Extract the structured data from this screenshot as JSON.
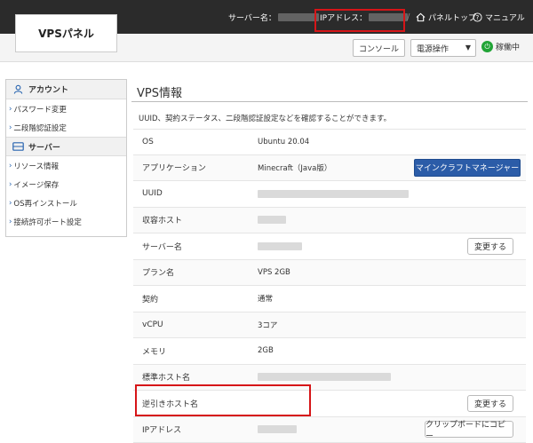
{
  "header": {
    "logo": "VPSパネル",
    "server_name_label": "サーバー名：",
    "ip_label": "IPアドレス：",
    "panel_top": "パネルトップ",
    "manual": "マニュアル"
  },
  "toolbar": {
    "console": "コンソール",
    "power_select": "電源操作",
    "status": "稼働中"
  },
  "sidebar": {
    "account_heading": "アカウント",
    "account_items": [
      "パスワード変更",
      "二段階認証設定"
    ],
    "server_heading": "サーバー",
    "server_items": [
      "リソース情報",
      "イメージ保存",
      "OS再インストール",
      "接続許可ポート設定"
    ]
  },
  "main": {
    "title": "VPS情報",
    "description": "UUID、契約ステータス、二段階認証設定などを確認することができます。",
    "rows": [
      {
        "label": "OS",
        "value": "Ubuntu 20.04"
      },
      {
        "label": "アプリケーション",
        "value": "Minecraft（Java版）",
        "button": "マインクラフトマネージャー"
      },
      {
        "label": "UUID",
        "value": ""
      },
      {
        "label": "収容ホスト",
        "value": ""
      },
      {
        "label": "サーバー名",
        "value": "",
        "button": "変更する"
      },
      {
        "label": "プラン名",
        "value": "VPS 2GB"
      },
      {
        "label": "契約",
        "value": "通常"
      },
      {
        "label": "vCPU",
        "value": "3コア"
      },
      {
        "label": "メモリ",
        "value": "2GB"
      },
      {
        "label": "標準ホスト名",
        "value": ""
      },
      {
        "label": "逆引きホスト名",
        "value": "",
        "button": "変更する"
      },
      {
        "label": "IPアドレス",
        "value": "",
        "button": "クリップボードにコピー"
      }
    ]
  },
  "colors": {
    "accent": "#2b5ca8",
    "highlight": "#d61518",
    "status_green": "#21a436",
    "topbar": "#2b2b2b"
  }
}
